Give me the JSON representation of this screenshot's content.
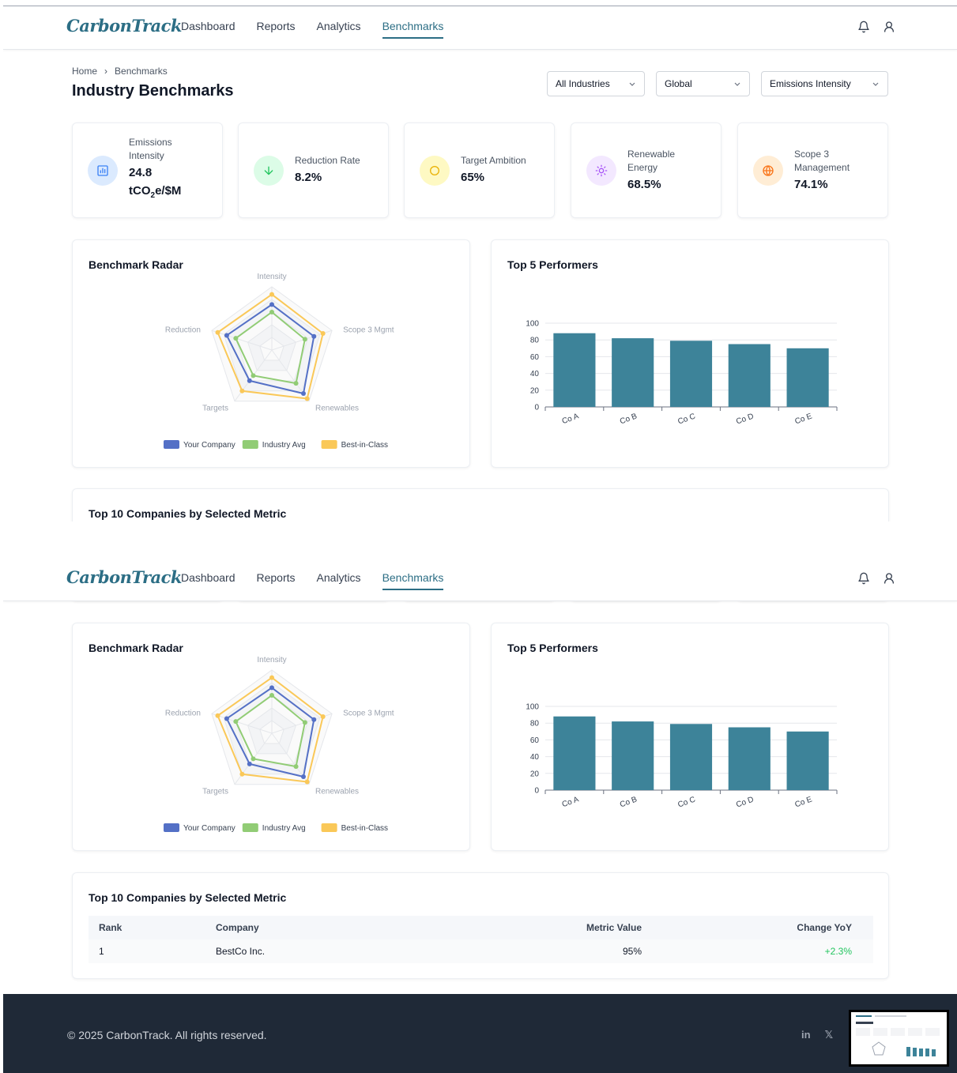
{
  "app": {
    "logo": "CarbonTrack",
    "nav": [
      "Dashboard",
      "Reports",
      "Analytics",
      "Benchmarks"
    ],
    "active_nav": "Benchmarks"
  },
  "breadcrumb": {
    "home": "Home",
    "separator": "›",
    "current": "Benchmarks"
  },
  "page": {
    "title": "Industry Benchmarks"
  },
  "filters": {
    "industry": "All Industries",
    "region": "Global",
    "metric": "Emissions Intensity"
  },
  "kpis": [
    {
      "label": "Emissions Intensity",
      "value": "24.8",
      "unit_prefix": "tCO",
      "unit_sub": "2",
      "unit_suffix": "e/$M",
      "icon": "chart-icon",
      "color": "#3b82f6",
      "bg": "#dbeafe"
    },
    {
      "label": "Reduction Rate",
      "value": "8.2%",
      "icon": "arrow-down-icon",
      "color": "#22c55e",
      "bg": "#dcfce7"
    },
    {
      "label": "Target Ambition",
      "value": "65%",
      "icon": "target-circle-icon",
      "color": "#eab308",
      "bg": "#fef9c3"
    },
    {
      "label": "Renewable Energy",
      "value": "68.5%",
      "icon": "sun-icon",
      "color": "#a855f7",
      "bg": "#f3e8ff"
    },
    {
      "label": "Scope 3 Management",
      "value": "74.1%",
      "icon": "globe-icon",
      "color": "#f97316",
      "bg": "#ffedd5"
    }
  ],
  "radar": {
    "title": "Benchmark Radar",
    "chart_data": {
      "type": "radar",
      "axes": [
        "Intensity",
        "Scope 3 Mgmt",
        "Renewables",
        "Targets",
        "Reduction"
      ],
      "rmax": 100,
      "series": [
        {
          "name": "Your Company",
          "color": "#5470c6",
          "values": [
            72,
            70,
            85,
            60,
            75
          ]
        },
        {
          "name": "Industry Avg",
          "color": "#91cc75",
          "values": [
            60,
            55,
            65,
            50,
            60
          ]
        },
        {
          "name": "Best-in-Class",
          "color": "#fac858",
          "values": [
            88,
            85,
            95,
            80,
            90
          ]
        }
      ]
    }
  },
  "bars": {
    "title": "Top 5 Performers",
    "chart_data": {
      "type": "bar",
      "categories": [
        "Co A",
        "Co B",
        "Co C",
        "Co D",
        "Co E"
      ],
      "values": [
        88,
        82,
        79,
        75,
        70
      ],
      "ylim": [
        0,
        100
      ],
      "yticks": [
        0,
        20,
        40,
        60,
        80,
        100
      ],
      "color": "#3d8399"
    }
  },
  "table": {
    "title": "Top 10 Companies by Selected Metric",
    "headers": [
      "Rank",
      "Company",
      "Metric Value",
      "Change YoY"
    ],
    "rows": [
      {
        "rank": "1",
        "company": "BestCo Inc.",
        "value": "95%",
        "change": "+2.3%"
      }
    ]
  },
  "footer": {
    "copyright": "© 2025 CarbonTrack. All rights reserved.",
    "social": [
      "in",
      "𝕏"
    ]
  }
}
